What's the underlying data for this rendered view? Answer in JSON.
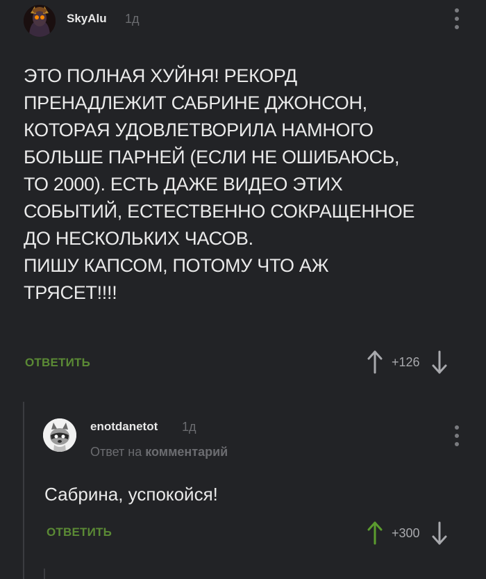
{
  "colors": {
    "background": "#222326",
    "reply_green": "#5b8a35",
    "upvote_active": "#5b9c2f",
    "muted": "#6b6c70"
  },
  "comments": [
    {
      "username": "SkyAlu",
      "age": "1д",
      "body": "ЭТО ПОЛНАЯ ХУЙНЯ! РЕКОРД\nПРЕНАДЛЕЖИТ САБРИНЕ ДЖОНСОН,\nКОТОРАЯ УДОВЛЕТВОРИЛА НАМНОГО\nБОЛЬШЕ ПАРНЕЙ (ЕСЛИ НЕ ОШИБАЮСЬ,\nТО 2000). ЕСТЬ ДАЖЕ ВИДЕО ЭТИХ\nСОБЫТИЙ, ЕСТЕСТВЕННО СОКРАЩЕННОЕ\nДО НЕСКОЛЬКИХ ЧАСОВ.\nПИШУ КАПСОМ, ПОТОМУ ЧТО АЖ\nТРЯСЕТ!!!!",
      "reply_label": "ОТВЕТИТЬ",
      "score": "+126",
      "upvote_icon": "arrow-up-icon",
      "downvote_icon": "arrow-down-icon"
    },
    {
      "username": "enotdanetot",
      "age": "1д",
      "reply_to_prefix": "Ответ на",
      "reply_to_target": "комментарий",
      "body": "Сабрина, успокойся!",
      "reply_label": "ОТВЕТИТЬ",
      "score": "+300",
      "upvote_icon": "arrow-up-icon",
      "upvote_active": true,
      "downvote_icon": "arrow-down-icon"
    }
  ]
}
